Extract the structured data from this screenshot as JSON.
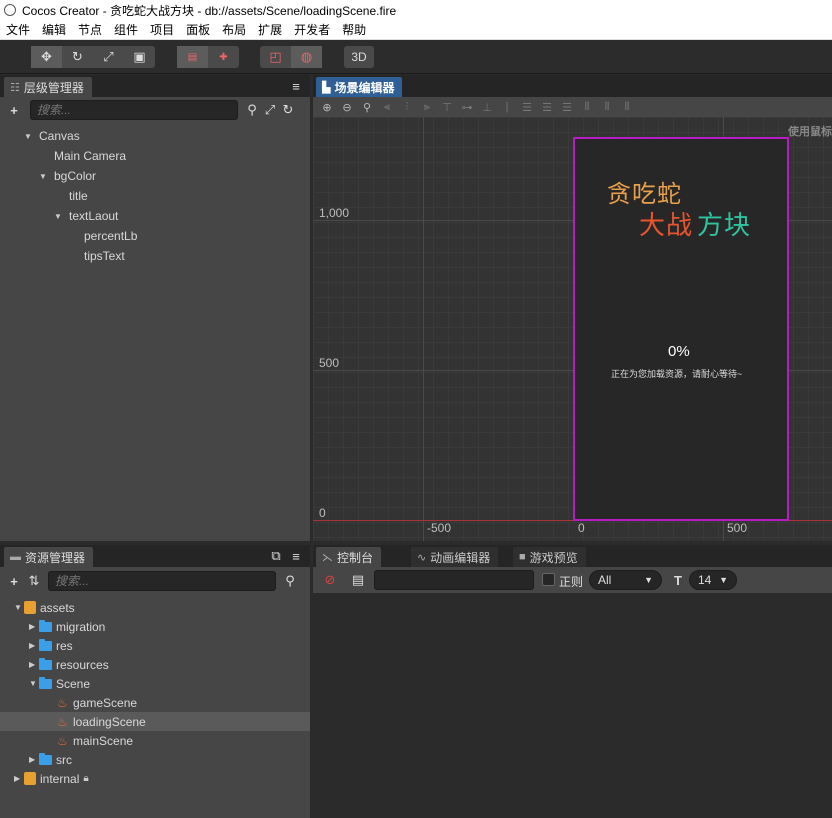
{
  "window": {
    "title": "Cocos Creator - 贪吃蛇大战方块 - db://assets/Scene/loadingScene.fire"
  },
  "menu": [
    "文件",
    "编辑",
    "节点",
    "组件",
    "项目",
    "面板",
    "布局",
    "扩展",
    "开发者",
    "帮助"
  ],
  "toolbar": {
    "transform_icons": [
      "move-icon",
      "rotate-icon",
      "scale-icon",
      "rect-icon"
    ],
    "anchor_icons": [
      "pivot-icon",
      "local-icon"
    ],
    "preview_icons": [
      "device-icon",
      "browser-icon"
    ],
    "mode_3d_label": "3D"
  },
  "hierarchy": {
    "tab_label": "层级管理器",
    "search_placeholder": "搜索...",
    "nodes": [
      {
        "label": "Canvas",
        "depth": 0,
        "expanded": true
      },
      {
        "label": "Main Camera",
        "depth": 1,
        "expanded": null
      },
      {
        "label": "bgColor",
        "depth": 1,
        "expanded": true
      },
      {
        "label": "title",
        "depth": 2,
        "expanded": null
      },
      {
        "label": "textLaout",
        "depth": 2,
        "expanded": true
      },
      {
        "label": "percentLb",
        "depth": 3,
        "expanded": null
      },
      {
        "label": "tipsText",
        "depth": 3,
        "expanded": null
      }
    ]
  },
  "scene_editor": {
    "tab_label": "场景编辑器",
    "hint": "使用鼠标",
    "y_labels": [
      "1,000",
      "500",
      "0"
    ],
    "x_labels": [
      "-500",
      "0",
      "500"
    ],
    "game": {
      "title_line1": "贪吃蛇",
      "title_line2a": "大战",
      "title_line2b": "方块",
      "percent": "0%",
      "tips": "正在为您加载资源，请耐心等待~",
      "colors": {
        "title1": "#e8a04a",
        "title2a": "#e8542e",
        "title2b": "#2ec4a0",
        "frame": "#b71cc4"
      }
    }
  },
  "assets": {
    "tab_label": "资源管理器",
    "search_placeholder": "搜索...",
    "items": [
      {
        "label": "assets",
        "type": "db",
        "depth": 0,
        "expanded": true
      },
      {
        "label": "migration",
        "type": "folder",
        "depth": 1,
        "expanded": false
      },
      {
        "label": "res",
        "type": "folder",
        "depth": 1,
        "expanded": false
      },
      {
        "label": "resources",
        "type": "folder",
        "depth": 1,
        "expanded": false
      },
      {
        "label": "Scene",
        "type": "folder",
        "depth": 1,
        "expanded": true
      },
      {
        "label": "gameScene",
        "type": "scene",
        "depth": 2,
        "expanded": null
      },
      {
        "label": "loadingScene",
        "type": "scene",
        "depth": 2,
        "expanded": null,
        "selected": true
      },
      {
        "label": "mainScene",
        "type": "scene",
        "depth": 2,
        "expanded": null
      },
      {
        "label": "src",
        "type": "folder",
        "depth": 1,
        "expanded": false
      },
      {
        "label": "internal",
        "type": "db",
        "depth": 0,
        "expanded": false,
        "locked": true
      }
    ]
  },
  "console": {
    "tabs": [
      {
        "label": "控制台",
        "icon": "console-icon"
      },
      {
        "label": "动画编辑器",
        "icon": "animation-icon"
      },
      {
        "label": "游戏预览",
        "icon": "camera-icon"
      }
    ],
    "regex_label": "正则",
    "level_value": "All",
    "font_size_value": "14"
  }
}
